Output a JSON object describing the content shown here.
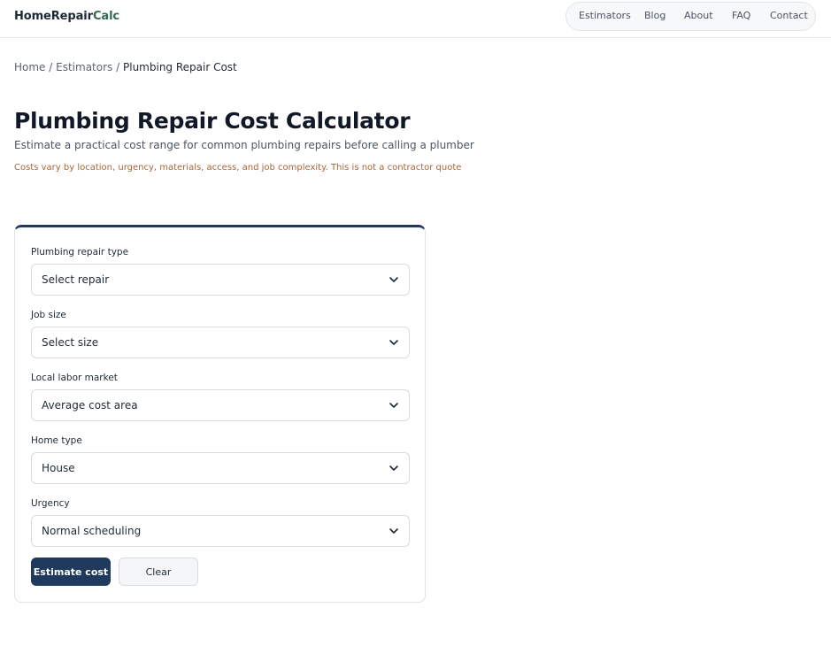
{
  "header": {
    "logo_main": "HomeRepair",
    "logo_accent": "Calc",
    "nav": [
      "Estimators",
      "Blog",
      "About",
      "FAQ",
      "Contact"
    ]
  },
  "breadcrumb": {
    "items": [
      "Home",
      "Estimators",
      "Plumbing Repair Cost"
    ],
    "separator": "/"
  },
  "page": {
    "title": "Plumbing Repair Cost Calculator",
    "subtitle": "Estimate a practical cost range for common plumbing repairs before calling a plumber",
    "disclaimer": "Costs vary by location, urgency, materials, access, and job complexity. This is not a contractor quote"
  },
  "form": {
    "fields": [
      {
        "label": "Plumbing repair type",
        "value": "Select repair"
      },
      {
        "label": "Job size",
        "value": "Select size"
      },
      {
        "label": "Local labor market",
        "value": "Average cost area"
      },
      {
        "label": "Home type",
        "value": "House"
      },
      {
        "label": "Urgency",
        "value": "Normal scheduling"
      }
    ],
    "estimate_label": "Estimate cost",
    "clear_label": "Clear"
  },
  "colors": {
    "accent": "#1f3a5c",
    "logo_accent": "#2f6b4f",
    "disclaimer": "#a8653a"
  }
}
